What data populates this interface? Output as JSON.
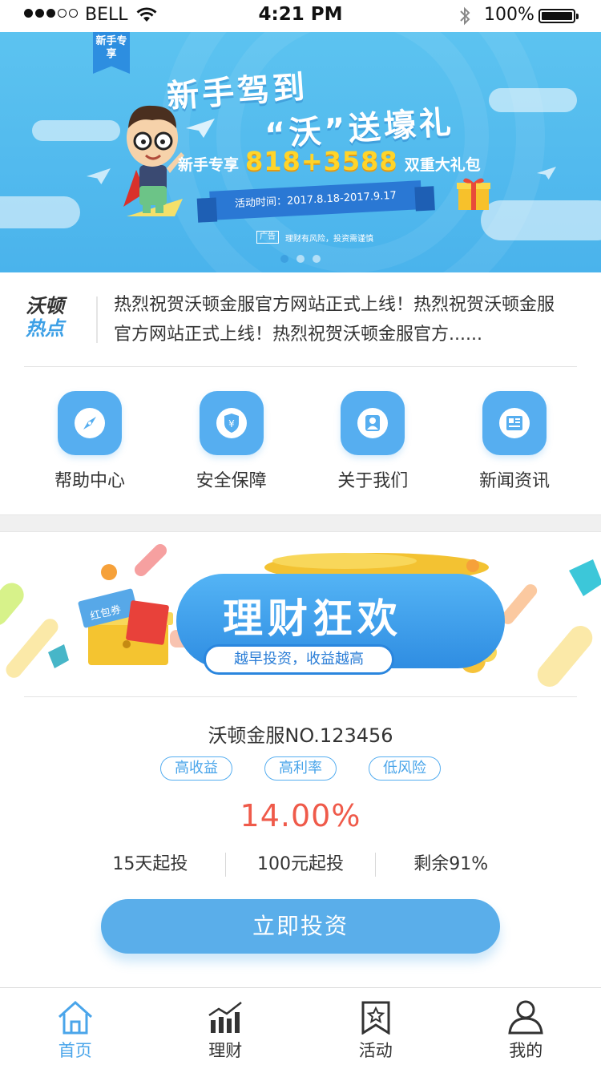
{
  "status_bar": {
    "carrier": "BELL",
    "time": "4:21 PM",
    "battery": "100%",
    "signal_bars_filled": 3,
    "signal_bars_total": 5
  },
  "banner": {
    "ribbon": "新手专享",
    "title_line1": "新手驾到",
    "title_line2": "“沃”送壕礼",
    "subtitle_prefix": "新手专享",
    "subtitle_amount": "818+3588",
    "subtitle_suffix": "双重大礼包",
    "date": "活动时间：2017.8.18-2017.9.17",
    "ad_tag": "广告",
    "ad_text": "理财有风险，投资需谨慎",
    "slide_count": 3,
    "active_slide": 0
  },
  "hot_news": {
    "logo_line1": "沃顿",
    "logo_line2": "热点",
    "text": "热烈祝贺沃顿金服官方网站正式上线！热烈祝贺沃顿金服官方网站正式上线！热烈祝贺沃顿金服官方......"
  },
  "shortcuts": [
    {
      "label": "帮助中心",
      "icon": "compass-icon"
    },
    {
      "label": "安全保障",
      "icon": "shield-yen-icon"
    },
    {
      "label": "关于我们",
      "icon": "user-icon"
    },
    {
      "label": "新闻资讯",
      "icon": "news-icon"
    }
  ],
  "promo": {
    "title": "理财狂欢",
    "subtitle": "越早投资，收益越高",
    "coupon_text": "红包券"
  },
  "product": {
    "name": "沃顿金服NO.123456",
    "tags": [
      "高收益",
      "高利率",
      "低风险"
    ],
    "rate": "14.00%",
    "stats": [
      "15天起投",
      "100元起投",
      "剩余91%"
    ],
    "button": "立即投资"
  },
  "tabbar": {
    "items": [
      {
        "label": "首页",
        "icon": "home-icon",
        "active": true
      },
      {
        "label": "理财",
        "icon": "bar-chart-icon",
        "active": false
      },
      {
        "label": "活动",
        "icon": "star-flag-icon",
        "active": false
      },
      {
        "label": "我的",
        "icon": "profile-icon",
        "active": false
      }
    ]
  },
  "colors": {
    "accent": "#56aef0",
    "rate": "#ef5a4a",
    "banner": "#5cc3f0"
  }
}
